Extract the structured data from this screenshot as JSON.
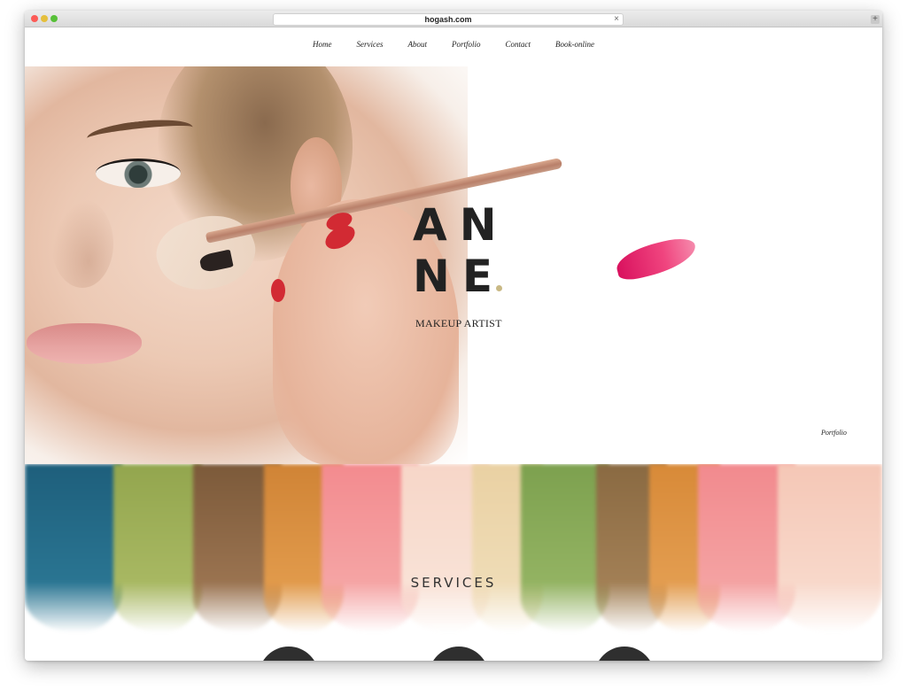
{
  "browser": {
    "url": "hogash.com",
    "close_glyph": "×",
    "plus_glyph": "+"
  },
  "nav": {
    "items": [
      "Home",
      "Services",
      "About",
      "Portfolio",
      "Contact",
      "Book-online"
    ]
  },
  "hero": {
    "name_line1": "AN",
    "name_line2": "NE",
    "tagline": "MAKEUP ARTIST",
    "portfolio_link": "Portfolio"
  },
  "services": {
    "title": "SERVICES"
  },
  "colors": {
    "accent_dot": "#c9b985",
    "lipstick": "#e0336b",
    "text": "#222222"
  }
}
